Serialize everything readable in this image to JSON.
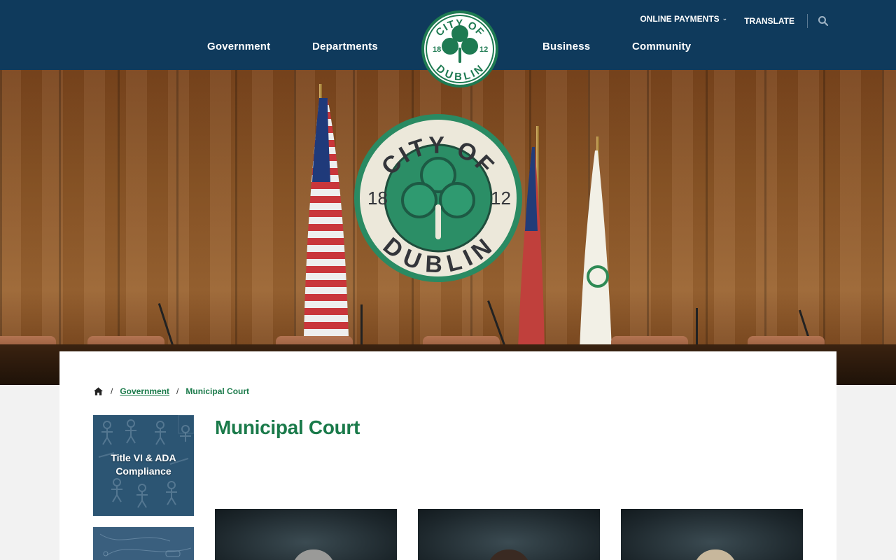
{
  "header": {
    "nav": [
      "Government",
      "Departments",
      "Business",
      "Community"
    ],
    "online_payments": "ONLINE PAYMENTS",
    "translate": "TRANSLATE",
    "seal": {
      "top": "CITY OF",
      "bottom": "DUBLIN",
      "left": "18",
      "right": "12"
    }
  },
  "breadcrumb": {
    "items": [
      "Government"
    ],
    "current": "Municipal Court"
  },
  "sidebar": {
    "cards": [
      {
        "label": "Title VI & ADA Compliance"
      }
    ]
  },
  "page": {
    "title": "Municipal Court"
  },
  "colors": {
    "navy": "#0f3a5c",
    "green": "#1a7a4a",
    "seal_green": "#1e7a52"
  },
  "icons": [
    "home-icon",
    "search-icon",
    "chevron-down-icon",
    "shamrock-icon"
  ]
}
